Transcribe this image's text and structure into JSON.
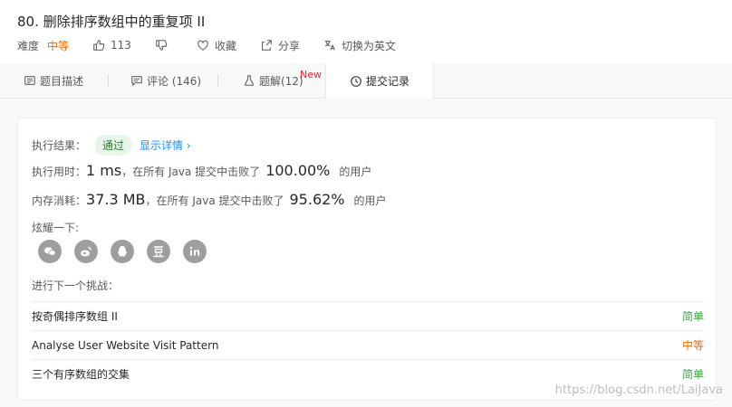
{
  "problem": {
    "title": "80. 删除排序数组中的重复项 II",
    "difficulty_label": "难度",
    "difficulty_value": "中等",
    "likes": "113",
    "favorite_label": "收藏",
    "share_label": "分享",
    "switch_lang_label": "切换为英文"
  },
  "tabs": [
    {
      "label": "题目描述"
    },
    {
      "label": "评论 (146)"
    },
    {
      "label": "题解(12)",
      "badge": "New"
    },
    {
      "label": "提交记录"
    }
  ],
  "result": {
    "label": "执行结果：",
    "status": "通过",
    "details_link": "显示详情 ›",
    "runtime_label": "执行用时：",
    "runtime_value": "1 ms",
    "runtime_middle": "，在所有 Java 提交中击败了",
    "runtime_percent": "100.00%",
    "runtime_suffix": "的用户",
    "memory_label": "内存消耗：",
    "memory_value": "37.3 MB",
    "memory_middle": "，在所有 Java 提交中击败了",
    "memory_percent": "95.62%",
    "memory_suffix": "的用户"
  },
  "share": {
    "label": "炫耀一下:",
    "icons": [
      "wechat-icon",
      "weibo-icon",
      "qq-icon",
      "douban-icon",
      "linkedin-icon"
    ]
  },
  "next": {
    "label": "进行下一个挑战：",
    "items": [
      {
        "title": "按奇偶排序数组 II",
        "difficulty": "简单"
      },
      {
        "title": "Analyse User Website Visit Pattern",
        "difficulty": "中等"
      },
      {
        "title": "三个有序数组的交集",
        "difficulty": "简单"
      }
    ]
  },
  "watermark": "https://blog.csdn.net/LaiJava",
  "colors": {
    "easy": "#43a047",
    "medium": "#ef6c00",
    "pass_bg": "#e8f5e9",
    "pass_text": "#2e7d32",
    "link": "#1890ff",
    "new_badge": "#f5222d"
  }
}
